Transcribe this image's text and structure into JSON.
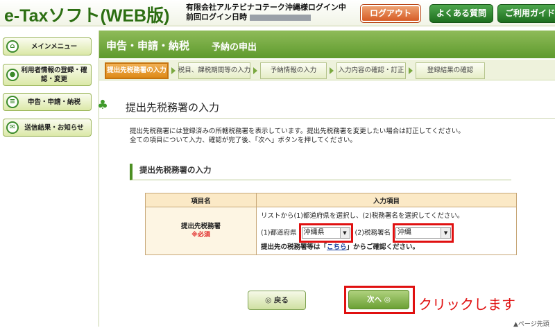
{
  "header": {
    "logo": "e-Taxソフト(WEB版)",
    "user_line1": "有限会社アルテビナコテーク沖縄様ログイン中",
    "user_line2_label": "前回ログイン日時",
    "logout_label": "ログアウト",
    "faq_label": "よくある質問",
    "guide_label": "ご利用ガイド"
  },
  "sidebar": {
    "items": [
      {
        "label": "メインメニュー",
        "icon": "home-icon"
      },
      {
        "label": "利用者情報の登録・確認・変更",
        "icon": "user-icon"
      },
      {
        "label": "申告・申請・納税",
        "icon": "document-icon"
      },
      {
        "label": "送信結果・お知らせ",
        "icon": "mail-icon"
      }
    ]
  },
  "page": {
    "title": "申告・申請・納税",
    "subtitle": "予納の申出",
    "steps": [
      "提出先税務署の入力",
      "税目、課税期間等の入力",
      "予納情報の入力",
      "入力内容の確認・訂正",
      "登録結果の確認"
    ],
    "section_title": "提出先税務署の入力",
    "desc_line1": "提出先税務署には登録済みの所轄税務署を表示しています。提出先税務署を変更したい場合は訂正してください。",
    "desc_line2": "全ての項目について入力、確認が完了後、「次へ」ボタンを押してください。",
    "sub_heading": "提出先税務署の入力"
  },
  "table": {
    "col_item": "項目名",
    "col_input": "入力項目",
    "row_label": "提出先税務署",
    "required": "※必須",
    "instruction": "リストから(1)都道府県を選択し、(2)税務署名を選択してください。",
    "prefecture_label": "(1)都道府県",
    "prefecture_value": "沖縄県",
    "office_label": "(2)税務署名",
    "office_value": "沖縄",
    "confirm_prefix": "提出先の税務署等は「",
    "confirm_link": "こちら",
    "confirm_suffix": "」からご確認ください。"
  },
  "buttons": {
    "back": "◎ 戻る",
    "next": "次へ ◎"
  },
  "annotation": "クリックします",
  "footer": {
    "top_link": "▲ページ先頭"
  },
  "colors": {
    "brand_green": "#2c6e12",
    "title_bar": "#6fa63a",
    "highlight_red": "#e01010",
    "logout_orange": "#d4561f"
  }
}
